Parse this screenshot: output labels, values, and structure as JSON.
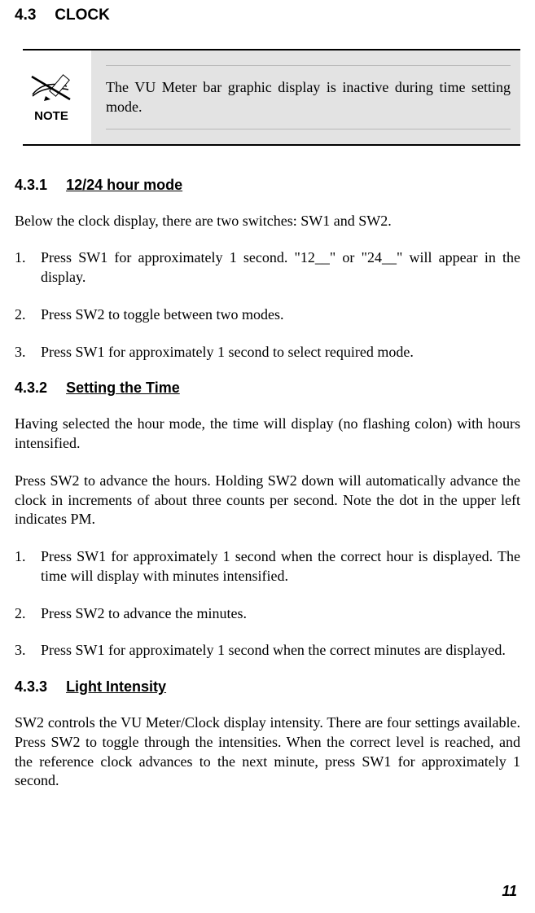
{
  "section": {
    "number": "4.3",
    "title": "CLOCK"
  },
  "note": {
    "label": "NOTE",
    "text": "The VU Meter bar graphic display is inactive during time setting mode."
  },
  "sub1": {
    "number": "4.3.1",
    "title": "12/24 hour mode",
    "intro": "Below the clock display, there are two switches: SW1 and SW2.",
    "items": [
      "Press SW1 for approximately 1 second.  \"12__\" or \"24__\" will appear in the display.",
      "Press SW2 to toggle between two modes.",
      "Press SW1 for approximately 1 second to select required mode."
    ]
  },
  "sub2": {
    "number": "4.3.2",
    "title": "Setting the Time",
    "intro1": "Having selected the hour mode, the time will display (no flashing colon) with hours intensified.",
    "intro2": "Press SW2 to advance the hours.  Holding SW2 down will automatically advance the clock in increments of about three counts per second.  Note the dot in the upper left indicates PM.",
    "items": [
      "Press SW1 for approximately 1 second when the correct hour is displayed.  The time will display with minutes intensified.",
      "Press SW2 to advance the minutes.",
      "Press SW1 for approximately 1 second when the correct minutes are displayed."
    ]
  },
  "sub3": {
    "number": "4.3.3",
    "title": "Light Intensity",
    "text": "SW2 controls the VU Meter/Clock display intensity.  There are four settings available.  Press SW2 to toggle through the intensities.  When the correct level is reached, and the reference clock advances to the next minute, press SW1 for approximately 1 second."
  },
  "page_number": "11",
  "list_numbers": [
    "1.",
    "2.",
    "3."
  ]
}
